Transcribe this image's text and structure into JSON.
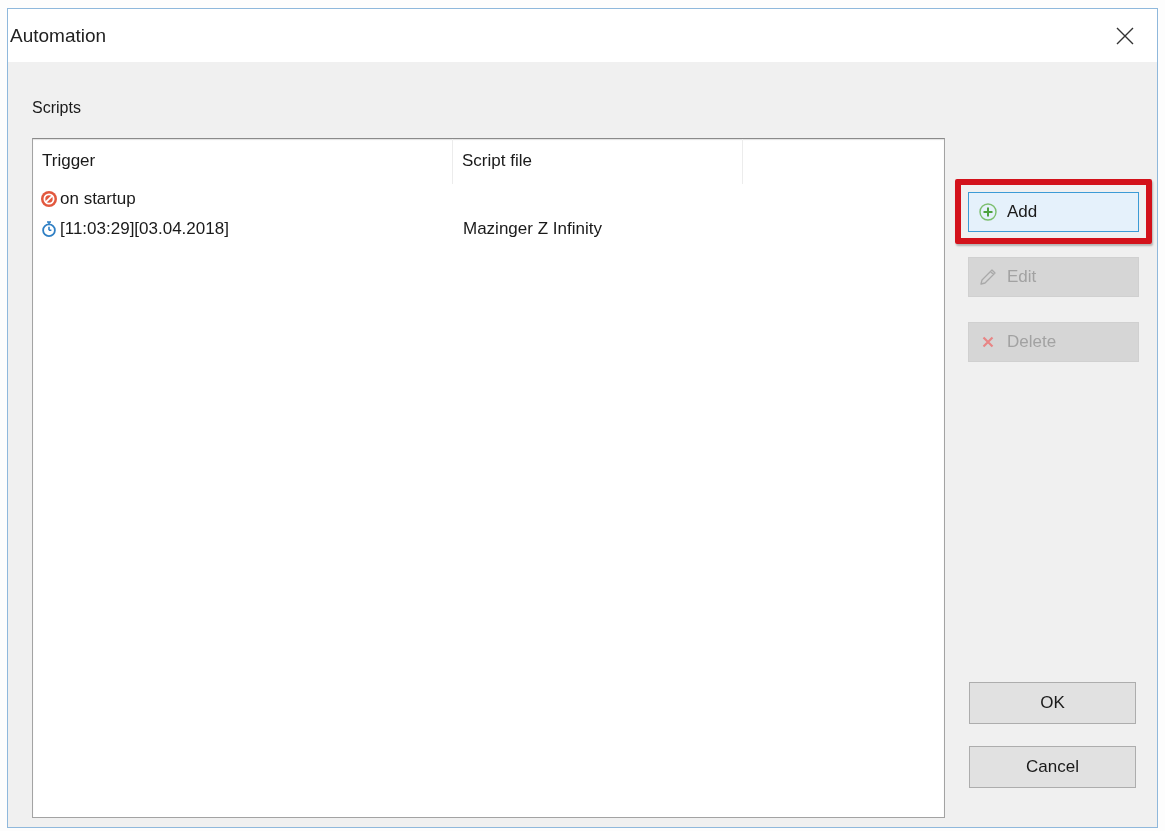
{
  "window": {
    "title": "Automation"
  },
  "scripts": {
    "label": "Scripts",
    "columns": [
      "Trigger",
      "Script file"
    ],
    "rows": [
      {
        "kind": "startup",
        "trigger": "on startup"
      },
      {
        "kind": "timer",
        "trigger": "[11:03:29][03.04.2018]",
        "script_file": "Mazinger Z Infinity"
      }
    ]
  },
  "buttons": [
    {
      "kind": "add",
      "label": "Add",
      "disabled": false,
      "focused": true,
      "highlighted": true
    },
    {
      "kind": "edit",
      "label": "Edit",
      "disabled": true,
      "focused": false,
      "highlighted": false
    },
    {
      "kind": "delete",
      "label": "Delete",
      "disabled": true,
      "focused": false,
      "highlighted": false
    }
  ],
  "dialog_buttons": [
    "OK",
    "Cancel"
  ]
}
